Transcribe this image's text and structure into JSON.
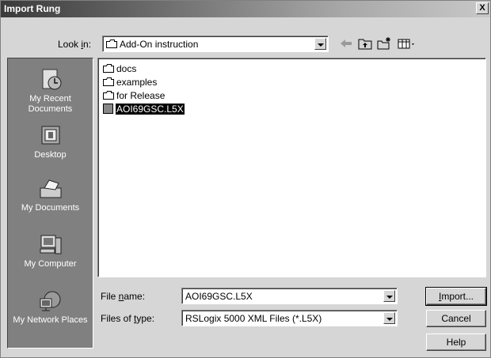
{
  "window": {
    "title": "Import Rung",
    "close_glyph": "X"
  },
  "lookin": {
    "label": "Look in:",
    "value": "Add-On instruction"
  },
  "toolbar": {
    "icons": [
      "back-icon",
      "up-folder-icon",
      "new-folder-icon",
      "view-menu-icon"
    ]
  },
  "places": [
    {
      "label": "My Recent Documents",
      "icon": "recent-documents-icon"
    },
    {
      "label": "Desktop",
      "icon": "desktop-icon"
    },
    {
      "label": "My Documents",
      "icon": "my-documents-icon"
    },
    {
      "label": "My Computer",
      "icon": "my-computer-icon"
    },
    {
      "label": "My Network Places",
      "icon": "network-places-icon"
    }
  ],
  "files": [
    {
      "name": "docs",
      "type": "folder"
    },
    {
      "name": "examples",
      "type": "folder"
    },
    {
      "name": "for Release",
      "type": "folder"
    },
    {
      "name": "AOI69GSC.L5X",
      "type": "file",
      "selected": true
    }
  ],
  "filename": {
    "label": "File name:",
    "value": "AOI69GSC.L5X"
  },
  "filetype": {
    "label": "Files of type:",
    "value": "RSLogix 5000 XML Files (*.L5X)"
  },
  "buttons": {
    "import": "Import...",
    "cancel": "Cancel",
    "help": "Help"
  }
}
